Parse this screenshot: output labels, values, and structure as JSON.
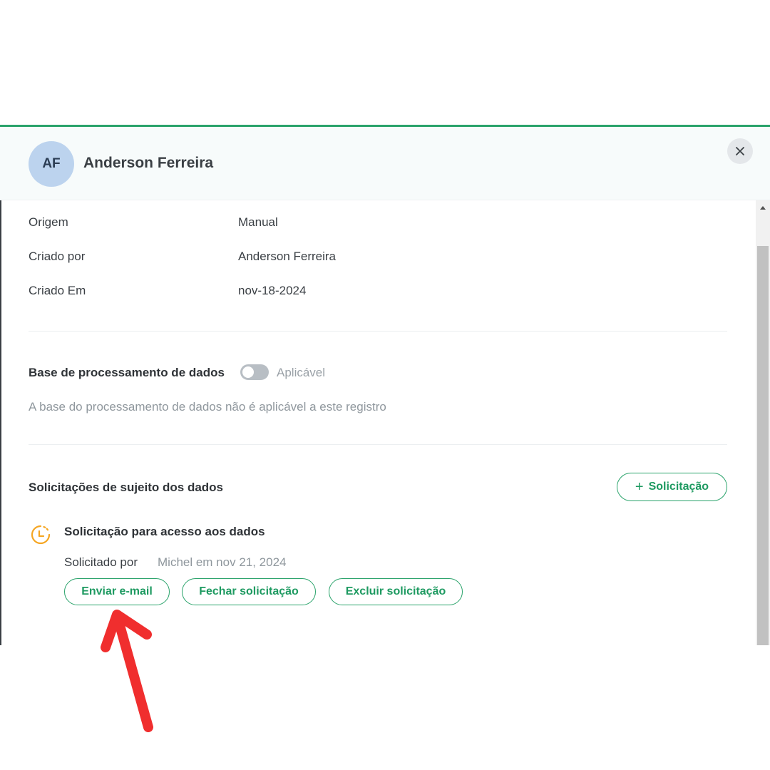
{
  "header": {
    "avatar_initials": "AF",
    "name": "Anderson Ferreira",
    "close_icon": "close-icon"
  },
  "details": [
    {
      "label": "Origem",
      "value": "Manual"
    },
    {
      "label": "Criado por",
      "value": "Anderson Ferreira"
    },
    {
      "label": "Criado Em",
      "value": "nov-18-2024"
    }
  ],
  "processing_basis": {
    "title": "Base de processamento de dados",
    "toggle_label": "Aplicável",
    "toggle_on": false,
    "note": "A base do processamento de dados não é aplicável a este registro"
  },
  "requests": {
    "title": "Solicitações de sujeito dos dados",
    "add_button_label": "Solicitação",
    "add_icon": "plus-icon",
    "item": {
      "status_icon": "clock-icon",
      "title": "Solicitação para acesso aos dados",
      "requested_by_label": "Solicitado por",
      "requested_by_value": "Michel em nov 21, 2024",
      "actions": {
        "send_email": "Enviar e-mail",
        "close_request": "Fechar solicitação",
        "delete_request": "Excluir solicitação"
      }
    }
  },
  "colors": {
    "accent": "#2aa36b",
    "pending": "#f5a623",
    "annotation": "#f02e2e"
  }
}
